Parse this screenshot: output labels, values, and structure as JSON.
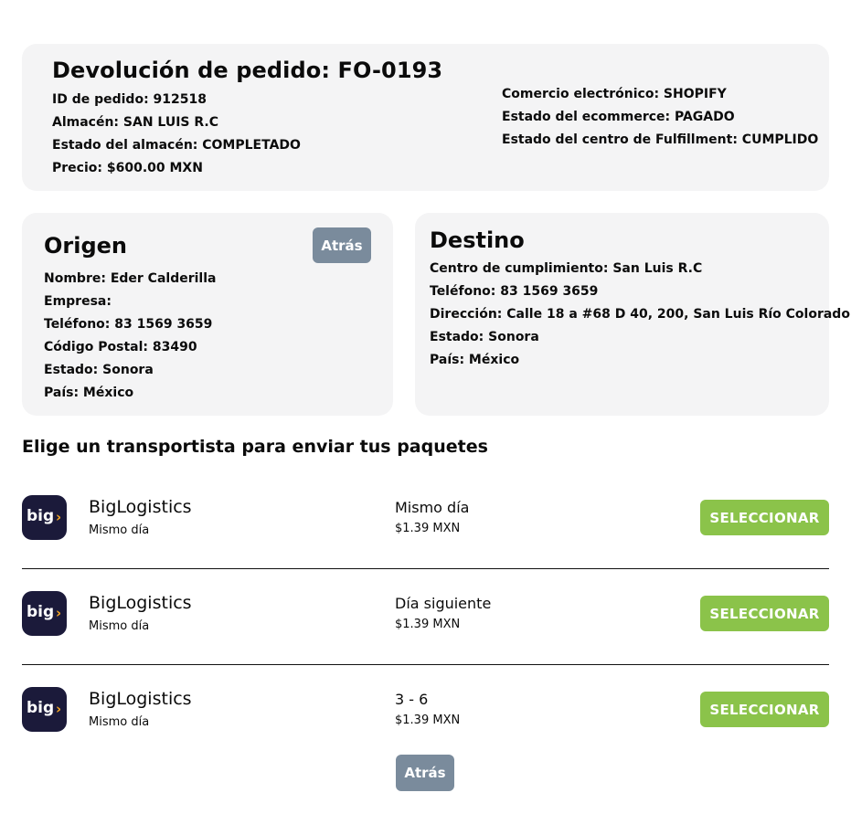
{
  "order": {
    "title": "Devolución de pedido: FO-0193",
    "left_lines": [
      "ID de pedido: 912518",
      "Almacén: SAN LUIS R.C",
      "Estado del almacén: COMPLETADO",
      "Precio: $600.00 MXN"
    ],
    "right_lines": [
      "Comercio electrónico: SHOPIFY",
      "Estado del ecommerce: PAGADO",
      "Estado del centro de Fulfillment: CUMPLIDO"
    ]
  },
  "origin": {
    "title": "Origen",
    "back_label": "Atrás",
    "lines": [
      "Nombre: Eder Calderilla",
      "Empresa:",
      "Teléfono: 83 1569 3659",
      "Código Postal: 83490",
      "Estado: Sonora",
      "País: México"
    ]
  },
  "destination": {
    "title": "Destino",
    "lines": [
      "Centro de cumplimiento: San Luis R.C",
      "Teléfono: 83 1569 3659",
      "Dirección: Calle 18 a #68 D 40, 200, San Luis Río Colorado",
      "Estado: Sonora",
      "País: México"
    ]
  },
  "carriers_section": {
    "title": "Elige un transportista para enviar tus paquetes",
    "select_label": "SELECCIONAR",
    "logo_text": "big",
    "logo_arrow": "›",
    "items": [
      {
        "name": "BigLogistics",
        "subtitle": "Mismo día",
        "service": "Mismo día",
        "price": "$1.39 MXN"
      },
      {
        "name": "BigLogistics",
        "subtitle": "Mismo día",
        "service": "Día siguiente",
        "price": "$1.39 MXN"
      },
      {
        "name": "BigLogistics",
        "subtitle": "Mismo día",
        "service": "3 - 6",
        "price": "$1.39 MXN"
      }
    ]
  },
  "footer": {
    "back_label": "Atrás"
  },
  "colors": {
    "card_bg": "#f4f4f5",
    "select_button": "#8bc34a",
    "back_button": "#7a8b9c",
    "logo_bg": "#1b1a3a",
    "logo_arrow": "#f5a623"
  }
}
